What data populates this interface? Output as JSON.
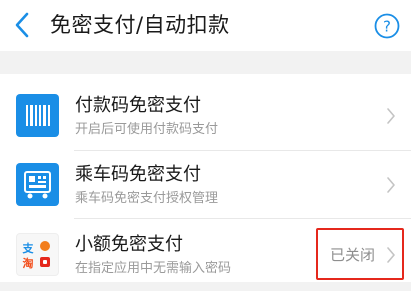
{
  "header": {
    "title": "免密支付/自动扣款",
    "back_icon": "back-arrow-icon",
    "help_icon": "question-circle-icon",
    "help_glyph": "?",
    "accent_color": "#1a8ee6"
  },
  "items": [
    {
      "title": "付款码免密支付",
      "subtitle": "开启后可使用付款码支付",
      "icon": "barcode-icon"
    },
    {
      "title": "乘车码免密支付",
      "subtitle": "乘车码免密支付授权管理",
      "icon": "bus-qr-icon"
    },
    {
      "title": "小额免密支付",
      "subtitle": "在指定应用中无需输入密码",
      "status": "已关闭",
      "icon": "multi-app-icon",
      "icon_glyphs": {
        "top_left": "支",
        "bottom_left": "淘"
      },
      "highlight_color": "#e5281c"
    }
  ]
}
